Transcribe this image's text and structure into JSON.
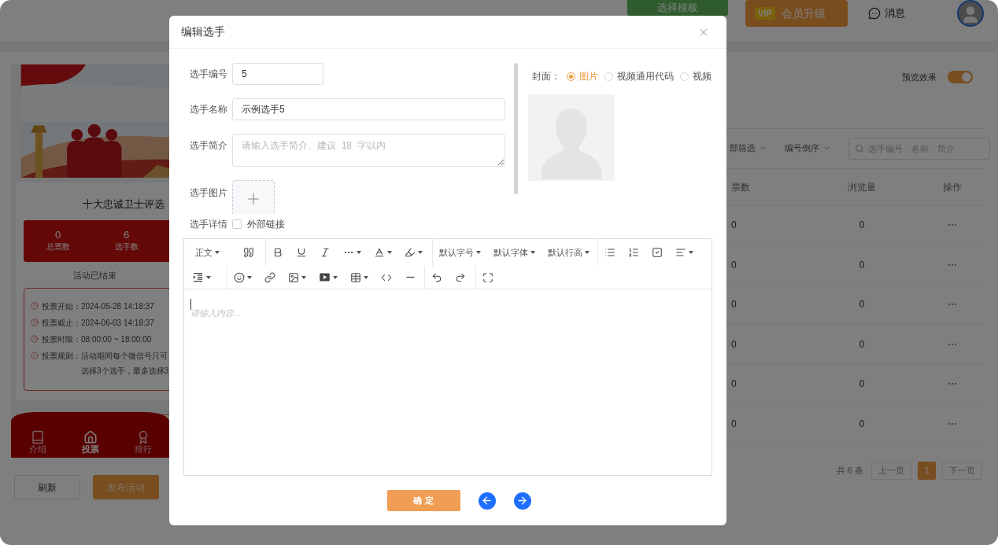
{
  "topbar": {
    "template_button": "选择模板",
    "vip_badge": "VIP",
    "vip_button": "会员升级",
    "messages": "消息"
  },
  "activity": {
    "title": "十大忠诚卫士评选",
    "stats": [
      {
        "value": "0",
        "label": "总票数"
      },
      {
        "value": "6",
        "label": "选手数"
      }
    ],
    "status": "活动已结束",
    "info": [
      {
        "kind": "time",
        "label": "投票开始：",
        "value": "2024-05-28 14:18:37"
      },
      {
        "kind": "time",
        "label": "投票截止：",
        "value": "2024-06-03 14:18:37"
      },
      {
        "kind": "time",
        "label": "投票时限：",
        "value": "08:00:00 ~ 18:00:00"
      },
      {
        "kind": "rule",
        "label": "投票规则：",
        "value": "活动期间每个微信号只可",
        "continuation": "选择3个选手，最多选择3"
      }
    ],
    "nav": [
      {
        "label": "介绍",
        "selected": false
      },
      {
        "label": "投票",
        "selected": true
      },
      {
        "label": "排行",
        "selected": false
      }
    ]
  },
  "actions": [
    "刷新",
    "发布活动"
  ],
  "preview": {
    "label": "预览效果",
    "on": true
  },
  "filters": [
    "部筛选",
    "编号倒序"
  ],
  "search": {
    "placeholder": "选手编号、名称、简介"
  },
  "table": {
    "columns": [
      "票数",
      "浏览量",
      "操作"
    ],
    "rows": [
      {
        "votes": "0",
        "views": "0"
      },
      {
        "votes": "0",
        "views": "0"
      },
      {
        "votes": "0",
        "views": "0"
      },
      {
        "votes": "0",
        "views": "0"
      },
      {
        "votes": "0",
        "views": "0"
      },
      {
        "votes": "0",
        "views": "0"
      }
    ]
  },
  "pagination": {
    "total": "共 6 条",
    "prev": "上一页",
    "pages": [
      {
        "label": "1",
        "selected": true
      }
    ],
    "next": "下一页"
  },
  "dialog": {
    "title": "编辑选手",
    "fields": [
      {
        "kind": "short_input",
        "label": "选手编号",
        "value": "5"
      },
      {
        "kind": "input",
        "label": "选手名称",
        "value": "示例选手5"
      },
      {
        "kind": "textarea",
        "label": "选手简介",
        "placeholder": "请输入选手简介、建议  18  字以内"
      },
      {
        "kind": "upload",
        "label": "选手图片"
      }
    ],
    "detail": {
      "label": "选手详情",
      "option": "外部链接",
      "checked": false
    },
    "cover": {
      "label": "封面：",
      "options": [
        {
          "label": "图片",
          "selected": true
        },
        {
          "label": "视频通用代码",
          "selected": false
        },
        {
          "label": "视频",
          "selected": false
        }
      ]
    },
    "editor": {
      "menus": [
        "正文",
        "默认字号",
        "默认字体",
        "默认行高"
      ],
      "placeholder": "请输入内容..."
    },
    "confirm": "确 定"
  }
}
